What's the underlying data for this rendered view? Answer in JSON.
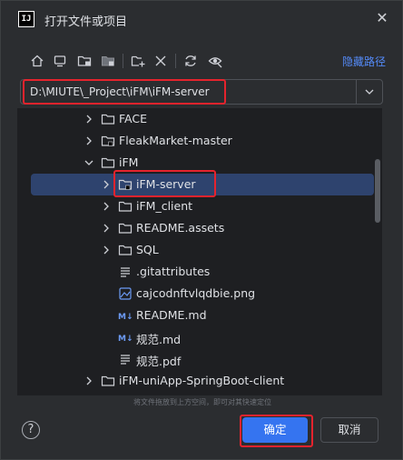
{
  "window": {
    "title": "打开文件或项目",
    "app_icon_text": "IJ"
  },
  "toolbar": {
    "buttons": [
      "home-icon",
      "desktop-icon",
      "project-folder-icon",
      "module-folder-icon",
      "new-folder-icon",
      "delete-icon",
      "refresh-icon",
      "show-hidden-icon"
    ],
    "hide_path_label": "隐藏路径"
  },
  "path": {
    "value": "D:\\MIUTE\\_Project\\iFM\\iFM-server"
  },
  "tree": {
    "items": [
      {
        "label": "FACE",
        "icon": "folder-icon",
        "chevron": "right"
      },
      {
        "label": "FleakMarket-master",
        "icon": "project-folder-icon",
        "chevron": "right"
      },
      {
        "label": "iFM",
        "icon": "folder-icon",
        "chevron": "down"
      },
      {
        "label": "iFM-server",
        "icon": "project-folder-icon",
        "chevron": "right",
        "selected": true
      },
      {
        "label": "iFM_client",
        "icon": "folder-icon",
        "chevron": "right"
      },
      {
        "label": "README.assets",
        "icon": "folder-icon",
        "chevron": "right"
      },
      {
        "label": "SQL",
        "icon": "folder-icon",
        "chevron": "right"
      },
      {
        "label": ".gitattributes",
        "icon": "text-file-icon",
        "chevron": "none"
      },
      {
        "label": "cajcodnftvlqdbie.png",
        "icon": "image-file-icon",
        "chevron": "none"
      },
      {
        "label": "README.md",
        "icon": "markdown-file-icon",
        "chevron": "none"
      },
      {
        "label": "规范.md",
        "icon": "markdown-file-icon",
        "chevron": "none"
      },
      {
        "label": "规范.pdf",
        "icon": "text-file-icon",
        "chevron": "none"
      },
      {
        "label": "iFM-uniApp-SpringBoot-client",
        "icon": "folder-icon",
        "chevron": "right"
      }
    ]
  },
  "footer": {
    "hint": "将文件拖放到上方空间，即可对其快速定位",
    "help_label": "?",
    "ok_label": "确定",
    "cancel_label": "取消"
  },
  "colors": {
    "background": "#2b2d30",
    "tree_background": "#1e1f22",
    "selection": "#2e436e",
    "accent": "#3574f0",
    "link": "#548af7",
    "highlight_box": "#e5232d"
  }
}
